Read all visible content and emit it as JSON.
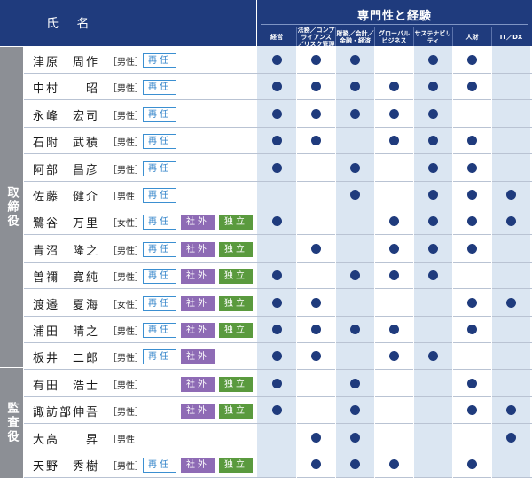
{
  "header": {
    "name_col": "氏 名",
    "group": "専門性と経験",
    "columns": [
      {
        "label": "経営"
      },
      {
        "label": "法務／コンプライアンス／リスク管理"
      },
      {
        "label": "財務／会計／金融・経済"
      },
      {
        "label": "グローバルビジネス"
      },
      {
        "label": "サステナビリティ"
      },
      {
        "label": "人財"
      },
      {
        "label": "IT／DX"
      }
    ]
  },
  "sections": [
    {
      "label": "取締役"
    },
    {
      "label": "監査役"
    }
  ],
  "badges": {
    "reappointed": "再任",
    "outside": "社外",
    "independent": "独立"
  },
  "colors": {
    "header": "#1f3b7d",
    "dot": "#1f3b7d",
    "reappointed": "#2c80c8",
    "outside": "#8e6bb5",
    "independent": "#5a9a3e",
    "column_shade": "#dbe6f2",
    "section": "#8c8f95"
  },
  "rows": [
    {
      "name": "津原　周作",
      "gender": "［男性］",
      "re": true,
      "ext": false,
      "ind": false,
      "skills": [
        1,
        1,
        1,
        0,
        1,
        1,
        0
      ]
    },
    {
      "name": "中村　　昭",
      "gender": "［男性］",
      "re": true,
      "ext": false,
      "ind": false,
      "skills": [
        1,
        1,
        1,
        1,
        1,
        1,
        0
      ]
    },
    {
      "name": "永峰　宏司",
      "gender": "［男性］",
      "re": true,
      "ext": false,
      "ind": false,
      "skills": [
        1,
        1,
        1,
        1,
        1,
        0,
        0
      ]
    },
    {
      "name": "石附　武積",
      "gender": "［男性］",
      "re": true,
      "ext": false,
      "ind": false,
      "skills": [
        1,
        1,
        0,
        1,
        1,
        1,
        0
      ]
    },
    {
      "name": "阿部　昌彦",
      "gender": "［男性］",
      "re": true,
      "ext": false,
      "ind": false,
      "skills": [
        1,
        0,
        1,
        0,
        1,
        1,
        0
      ]
    },
    {
      "name": "佐藤　健介",
      "gender": "［男性］",
      "re": true,
      "ext": false,
      "ind": false,
      "skills": [
        0,
        0,
        1,
        0,
        1,
        1,
        1
      ]
    },
    {
      "name": "鷺谷　万里",
      "gender": "［女性］",
      "re": true,
      "ext": true,
      "ind": true,
      "skills": [
        1,
        0,
        0,
        1,
        1,
        1,
        1
      ]
    },
    {
      "name": "青沼　隆之",
      "gender": "［男性］",
      "re": true,
      "ext": true,
      "ind": true,
      "skills": [
        0,
        1,
        0,
        1,
        1,
        1,
        0
      ]
    },
    {
      "name": "曽禰　寛純",
      "gender": "［男性］",
      "re": true,
      "ext": true,
      "ind": true,
      "skills": [
        1,
        0,
        1,
        1,
        1,
        0,
        0
      ]
    },
    {
      "name": "渡邉　夏海",
      "gender": "［女性］",
      "re": true,
      "ext": true,
      "ind": true,
      "skills": [
        1,
        1,
        0,
        0,
        0,
        1,
        1
      ]
    },
    {
      "name": "浦田　晴之",
      "gender": "［男性］",
      "re": true,
      "ext": true,
      "ind": true,
      "skills": [
        1,
        1,
        1,
        1,
        0,
        1,
        0
      ]
    },
    {
      "name": "板井　二郎",
      "gender": "［男性］",
      "re": true,
      "ext": true,
      "ind": false,
      "skills": [
        1,
        1,
        0,
        1,
        1,
        0,
        0
      ]
    },
    {
      "name": "有田　浩士",
      "gender": "［男性］",
      "re": false,
      "ext": true,
      "ind": true,
      "skills": [
        1,
        0,
        1,
        0,
        0,
        1,
        0
      ]
    },
    {
      "name": "諏訪部伸吾",
      "gender": "［男性］",
      "re": false,
      "ext": true,
      "ind": true,
      "skills": [
        1,
        0,
        1,
        0,
        0,
        1,
        1
      ]
    },
    {
      "name": "大高　　昇",
      "gender": "［男性］",
      "re": false,
      "ext": false,
      "ind": false,
      "skills": [
        0,
        1,
        1,
        0,
        0,
        0,
        1
      ]
    },
    {
      "name": "天野　秀樹",
      "gender": "［男性］",
      "re": true,
      "ext": true,
      "ind": true,
      "skills": [
        0,
        1,
        1,
        1,
        0,
        1,
        0
      ]
    }
  ]
}
